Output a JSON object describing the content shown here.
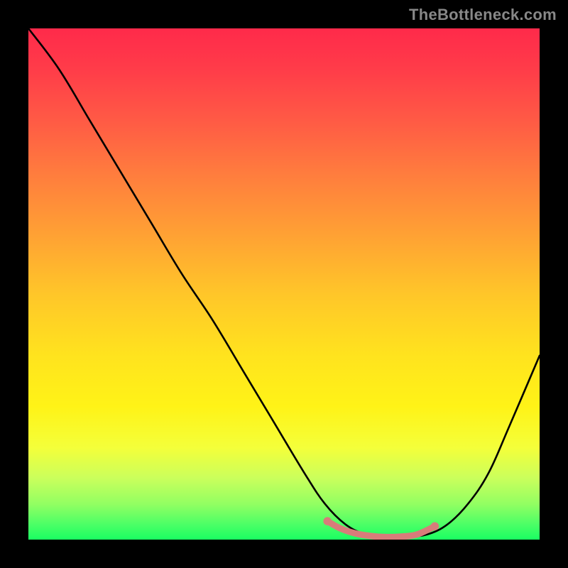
{
  "watermark": "TheBottleneck.com",
  "chart_data": {
    "type": "line",
    "title": "",
    "xlabel": "",
    "ylabel": "",
    "xlim": [
      0,
      100
    ],
    "ylim": [
      0,
      100
    ],
    "grid": false,
    "legend": false,
    "series": [
      {
        "name": "curve",
        "color": "#000000",
        "x": [
          0,
          6,
          12,
          18,
          24,
          30,
          36,
          42,
          48,
          54,
          58,
          62,
          66,
          70,
          74,
          78,
          82,
          86,
          90,
          94,
          100
        ],
        "y": [
          100,
          92,
          82,
          72,
          62,
          52,
          43,
          33,
          23,
          13,
          7,
          3,
          1,
          0.5,
          0.6,
          1.0,
          3.0,
          7.0,
          13,
          22,
          36
        ]
      },
      {
        "name": "optimal-range",
        "color": "#d87c7a",
        "x": [
          58.5,
          61,
          64,
          67,
          70,
          73,
          76,
          79.5
        ],
        "y": [
          3.6,
          2.2,
          1.2,
          0.7,
          0.5,
          0.6,
          1.0,
          2.6
        ]
      }
    ],
    "background_gradient": {
      "top": "#ff2a4a",
      "mid": "#ffd522",
      "bottom": "#1aff62"
    }
  }
}
